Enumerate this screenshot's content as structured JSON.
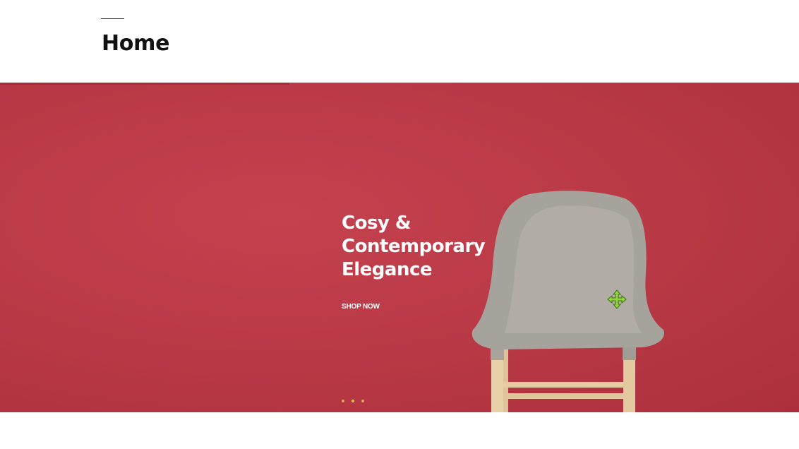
{
  "header": {
    "title": "Home"
  },
  "hero": {
    "headline_line1": "Cosy &",
    "headline_line2": "Contemporary",
    "headline_line3": "Elegance",
    "cta_label": "SHOP NOW",
    "background_color": "#bb3a47",
    "slides": [
      {
        "active": false
      },
      {
        "active": true
      },
      {
        "active": false
      }
    ]
  },
  "cursor": {
    "icon": "move-cursor-icon",
    "color": "#8fd63a"
  }
}
